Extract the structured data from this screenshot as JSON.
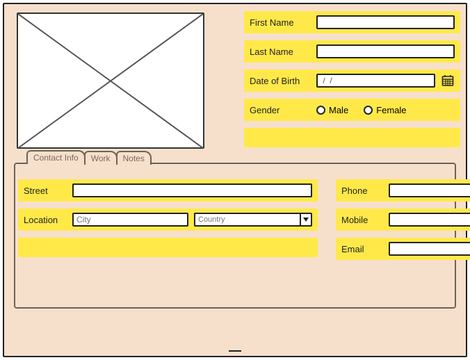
{
  "profile": {
    "first_name_label": "First Name",
    "first_name_value": "",
    "last_name_label": "Last Name",
    "last_name_value": "",
    "dob_label": "Date of Birth",
    "dob_value": " /  / ",
    "gender_label": "Gender",
    "gender_options": {
      "male": "Male",
      "female": "Female"
    }
  },
  "tabs": {
    "contact": "Contact Info",
    "work": "Work",
    "notes": "Notes"
  },
  "contact": {
    "street_label": "Street",
    "street_value": "",
    "location_label": "Location",
    "city_placeholder": "City",
    "country_placeholder": "Country",
    "phone_label": "Phone",
    "phone_value": "",
    "mobile_label": "Mobile",
    "mobile_value": "",
    "email_label": "Email",
    "email_value": ""
  }
}
